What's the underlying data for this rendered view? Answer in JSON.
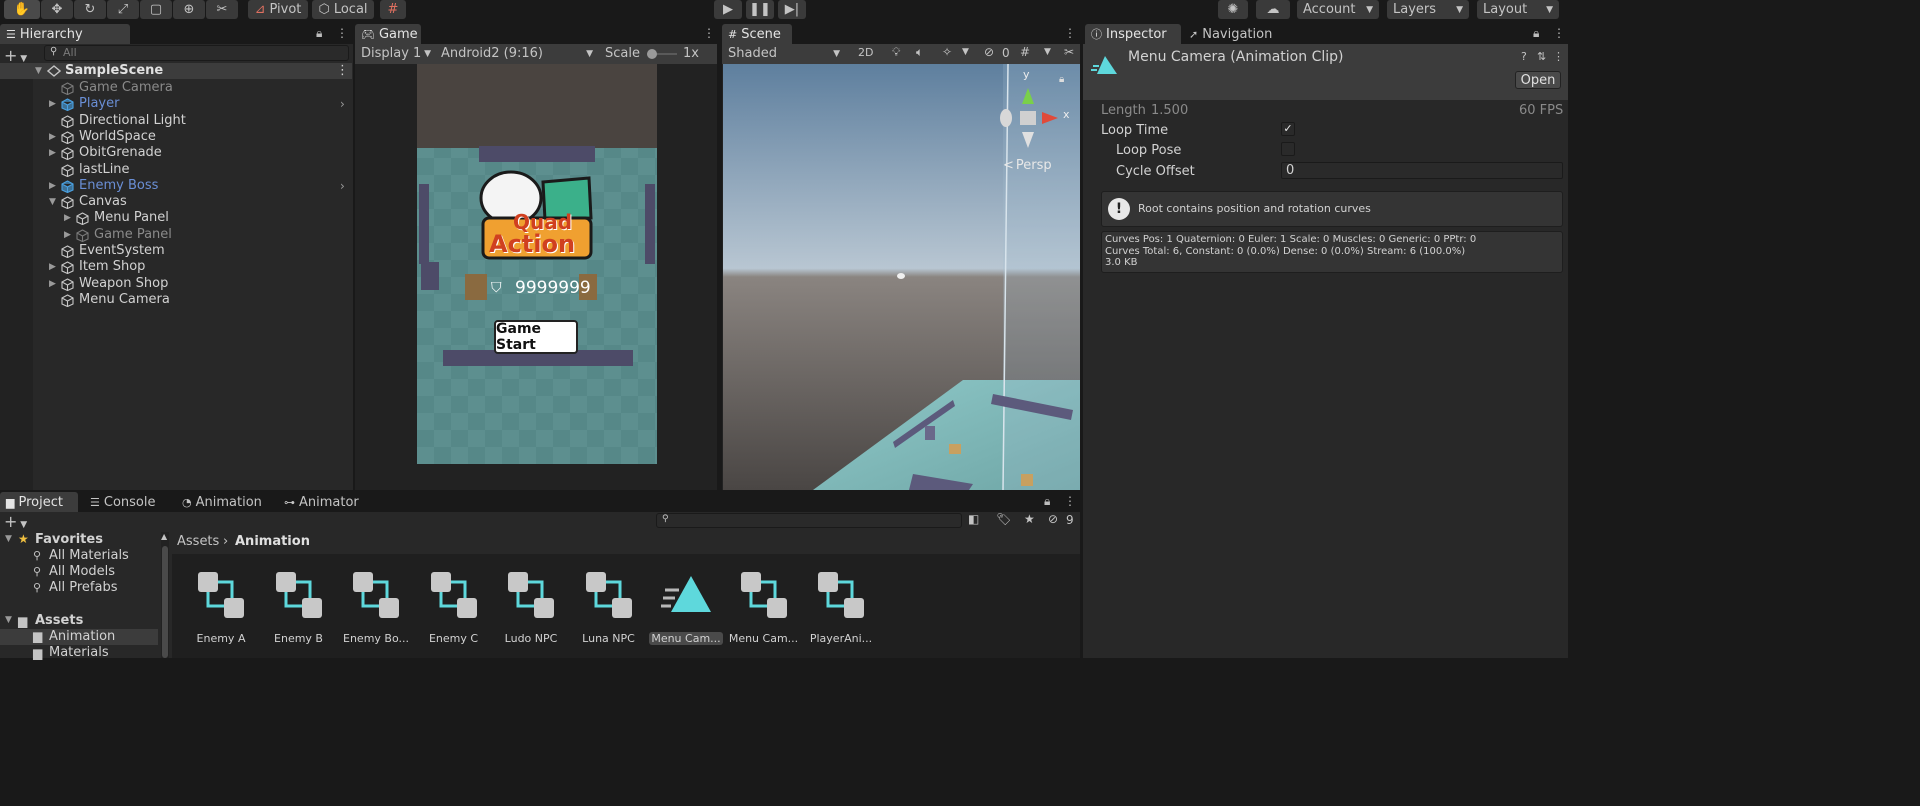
{
  "toolbar": {
    "pivot": "Pivot",
    "local": "Local",
    "account": "Account",
    "layers": "Layers",
    "layout": "Layout"
  },
  "hierarchy": {
    "tab": "Hierarchy",
    "search_placeholder": "All",
    "scene": "SampleScene",
    "items": [
      {
        "label": "Game Camera",
        "state": "dim"
      },
      {
        "label": "Player",
        "state": "prefab"
      },
      {
        "label": "Directional Light",
        "state": "normal"
      },
      {
        "label": "WorldSpace",
        "state": "normal"
      },
      {
        "label": "ObitGrenade",
        "state": "normal"
      },
      {
        "label": "lastLine",
        "state": "normal"
      },
      {
        "label": "Enemy Boss",
        "state": "prefab"
      },
      {
        "label": "Canvas",
        "state": "normal"
      },
      {
        "label": "Menu Panel",
        "state": "normal"
      },
      {
        "label": "Game Panel",
        "state": "dim"
      },
      {
        "label": "EventSystem",
        "state": "normal"
      },
      {
        "label": "Item Shop",
        "state": "normal"
      },
      {
        "label": "Weapon Shop",
        "state": "normal"
      },
      {
        "label": "Menu Camera",
        "state": "normal"
      }
    ]
  },
  "game": {
    "tab": "Game",
    "display": "Display 1",
    "resolution": "Android2 (9:16)",
    "scale_label": "Scale",
    "scale_value": "1x",
    "score": "9999999",
    "start_button": "Game Start",
    "logo_line1": "Quad",
    "logo_line2": "Action"
  },
  "scene": {
    "tab": "Scene",
    "shading": "Shaded",
    "mode2d": "2D",
    "hidden_count": "0",
    "persp": "Persp",
    "axis_y": "y",
    "axis_x": "x"
  },
  "inspector": {
    "tab": "Inspector",
    "tab2": "Navigation",
    "title": "Menu Camera (Animation Clip)",
    "open_button": "Open",
    "length_label": "Length",
    "length_value": "1.500",
    "fps": "60 FPS",
    "loop_time": "Loop Time",
    "loop_time_checked": true,
    "loop_pose": "Loop Pose",
    "loop_pose_checked": false,
    "cycle_offset": "Cycle Offset",
    "cycle_offset_value": "0",
    "warning": "Root contains position and rotation curves",
    "info_line1": "Curves Pos: 1 Quaternion: 0 Euler: 1 Scale: 0 Muscles: 0 Generic: 0 PPtr: 0",
    "info_line2": "Curves Total: 6, Constant: 0 (0.0%) Dense: 0 (0.0%) Stream: 6 (100.0%)",
    "info_line3": "3.0 KB"
  },
  "bottom": {
    "tabs": [
      "Project",
      "Console",
      "Animation",
      "Animator"
    ],
    "hidden_count": "9",
    "breadcrumb_root": "Assets",
    "breadcrumb_current": "Animation",
    "favorites": "Favorites",
    "fav_items": [
      "All Materials",
      "All Models",
      "All Prefabs"
    ],
    "assets_root": "Assets",
    "folders": [
      "Animation",
      "Materials"
    ],
    "assets": [
      {
        "name": "Enemy A",
        "type": "controller"
      },
      {
        "name": "Enemy B",
        "type": "controller"
      },
      {
        "name": "Enemy Bo...",
        "type": "controller"
      },
      {
        "name": "Enemy C",
        "type": "controller"
      },
      {
        "name": "Ludo NPC",
        "type": "controller"
      },
      {
        "name": "Luna NPC",
        "type": "controller"
      },
      {
        "name": "Menu Cam...",
        "type": "clip",
        "selected": true
      },
      {
        "name": "Menu Cam...",
        "type": "controller"
      },
      {
        "name": "PlayerAni...",
        "type": "controller"
      }
    ]
  },
  "colors": {
    "accent": "#5ed8dc",
    "selection": "#2c5d87",
    "prefab_blue": "#6a8fd6"
  }
}
